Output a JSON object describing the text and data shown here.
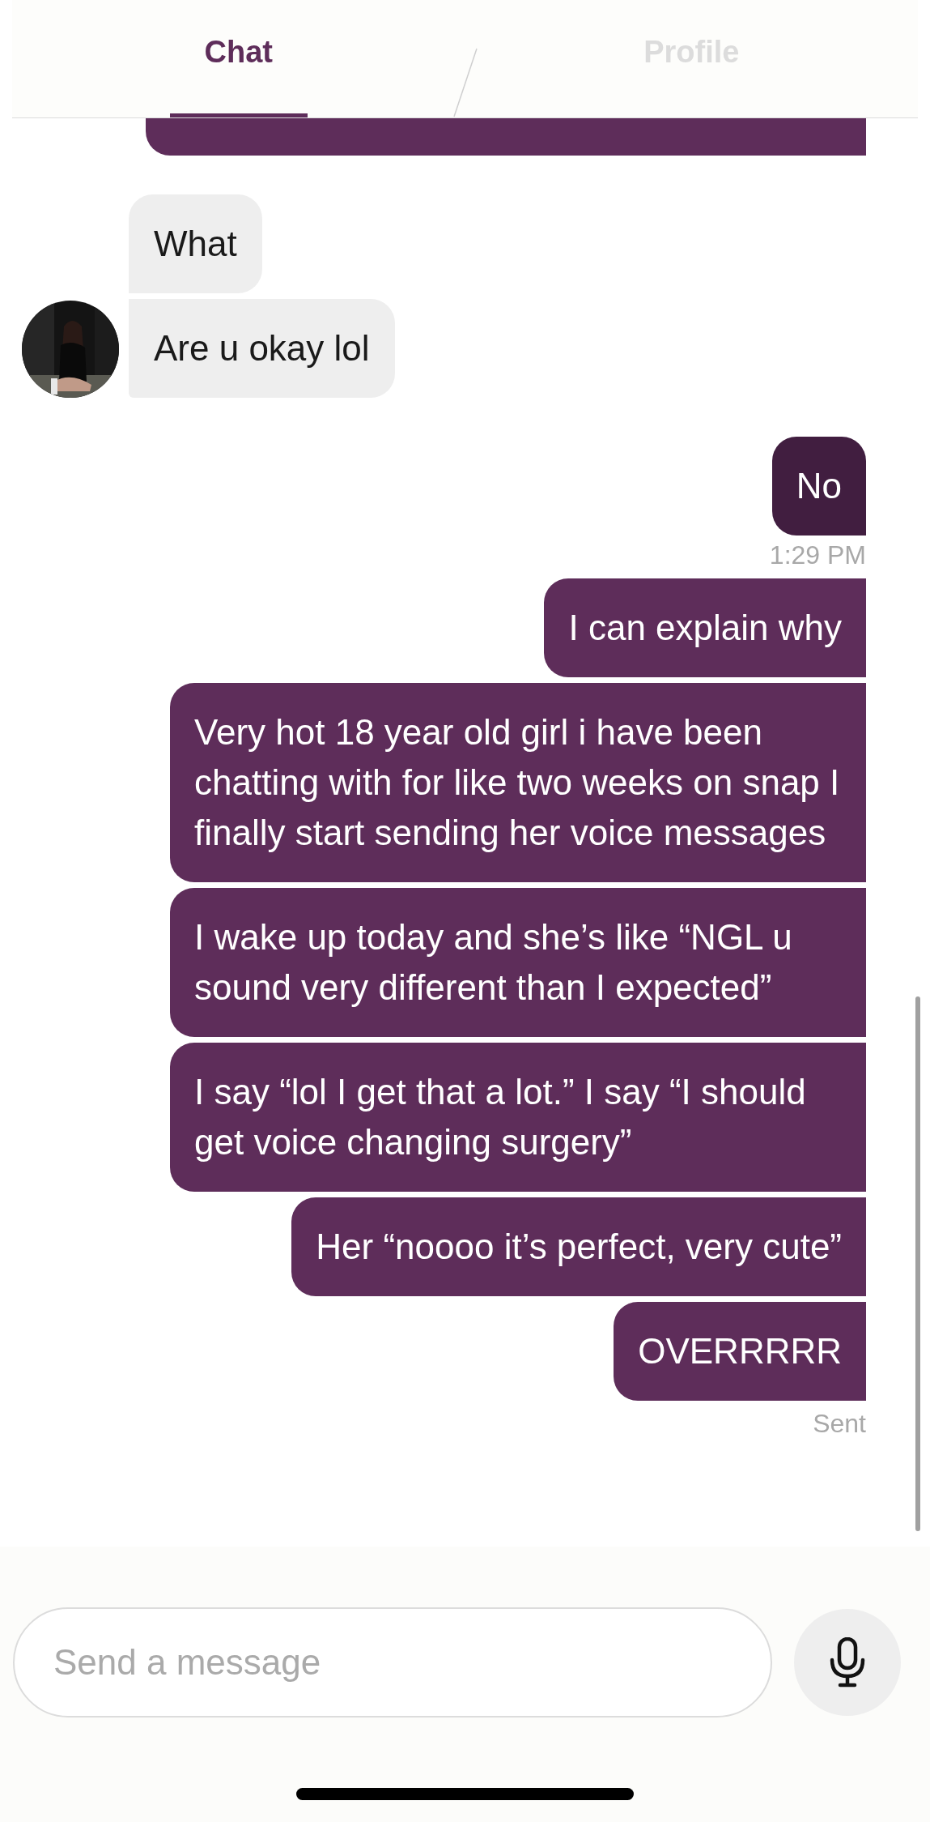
{
  "tabs": [
    {
      "label": "Chat",
      "selected": true
    },
    {
      "label": "Profile",
      "selected": false
    }
  ],
  "messages": [
    {
      "kind": "incoming",
      "text": "What",
      "avatar": false
    },
    {
      "kind": "incoming",
      "text": "Are u okay lol",
      "avatar": true
    },
    {
      "kind": "outgoing",
      "text": "No",
      "highlighted": true,
      "timestamp": "1:29 PM"
    },
    {
      "kind": "outgoing",
      "text": "I can explain why",
      "highlighted": false
    },
    {
      "kind": "outgoing",
      "text": "Very hot 18 year old girl i have been chatting with for like two weeks on snap I finally start sending her voice messages",
      "highlighted": false
    },
    {
      "kind": "outgoing",
      "text": "I wake up today and she’s like “NGL u sound very different than I expected”",
      "highlighted": false
    },
    {
      "kind": "outgoing",
      "text": "I say “lol I get that a lot.” I say “I should get voice changing surgery”",
      "highlighted": false
    },
    {
      "kind": "outgoing",
      "text": "Her “noooo it’s perfect, very cute”",
      "highlighted": false
    },
    {
      "kind": "outgoing",
      "text": "OVERRRRR",
      "highlighted": false,
      "status": "Sent"
    }
  ],
  "composer": {
    "placeholder": "Send a message"
  }
}
